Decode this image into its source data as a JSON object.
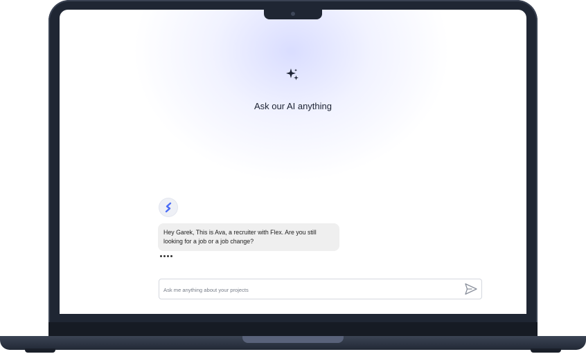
{
  "hero": {
    "icon": "sparkles-icon",
    "title": "Ask our AI anything"
  },
  "chat": {
    "assistant_avatar_icon": "flex-logo-icon",
    "accent_color": "#4a6cf7",
    "messages": [
      {
        "sender": "assistant",
        "text": "Hey Garek, This is Ava, a recruiter with Flex. Are you still looking for a job or a job change?"
      }
    ],
    "typing_indicator": "••••"
  },
  "composer": {
    "placeholder": "Ask me anything about your projects",
    "value": "",
    "send_icon": "send-icon"
  },
  "device": {
    "frame_color": "#1f2633",
    "screen_glow_color": "#cdd2ff"
  }
}
